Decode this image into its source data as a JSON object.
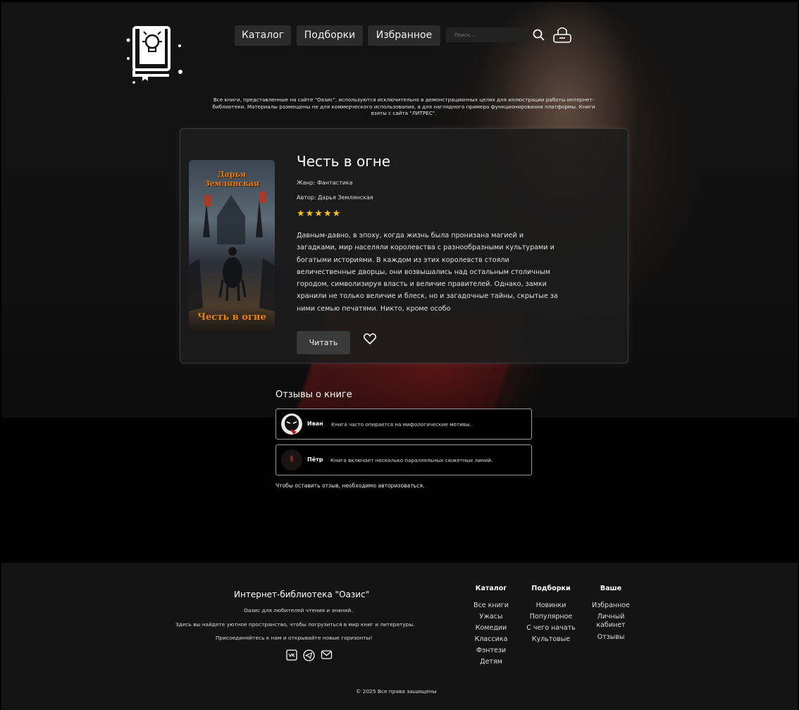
{
  "nav": {
    "catalog": "Каталог",
    "collections": "Подборки",
    "favorites": "Избранное",
    "search_placeholder": "Поиск..."
  },
  "disclaimer": "Все книги, представленные на сайте \"Оазис\", используются исключительно в демонстрационных целях для иллюстрации работы интернет-библиотеки. Материалы размещены не для коммерческого использования, а для наглядного примера функционирования платформы. Книги взяты с сайта \"ЛИТРЕС\".",
  "book": {
    "title": "Честь в огне",
    "genre": "Жанр: Фантастика",
    "author": "Автор: Дарья Землянская",
    "rating": 5,
    "stars": "★★★★★",
    "cover_author": "Дарья Землянская",
    "cover_title": "Честь в огне",
    "description": "Давным-давно, в эпоху, когда жизнь была пронизана магией и загадками, мир населяли королевства с разнообразными культурами и богатыми историями. В каждом из этих королевств стояли величественные дворцы, они возвышались над остальным столичным городом, символизируя власть и величие правителей. Однако, замки хранили не только величие и блеск, но и загадочные тайны, скрытые за ними семью печатями. Никто, кроме особо",
    "read_label": "Читать"
  },
  "reviews": {
    "title": "Отзывы о книге",
    "items": [
      {
        "name": "Иван",
        "text": "Книга часто опирается на мифологические мотивы."
      },
      {
        "name": "Пётр",
        "text": "Книга включает несколько параллельных сюжетных линий."
      }
    ],
    "auth_note": "Чтобы оставить отзыв, необходимо авторизоваться."
  },
  "footer": {
    "title": "Интернет-библиотека \"Оазис\"",
    "line1": "Оазис для любителей чтения и знаний.",
    "line2": "Здесь вы найдете уютное пространство, чтобы погрузиться в мир книг и литературы.",
    "line3": "Присоединяйтесь к нам и открывайте новые горизонты!",
    "columns": [
      {
        "head": "Каталог",
        "links": [
          "Все книги",
          "Ужасы",
          "Комедии",
          "Классика",
          "Фэнтези",
          "Детям"
        ]
      },
      {
        "head": "Подборки",
        "links": [
          "Новинки",
          "Популярное",
          "С чего начать",
          "Культовые"
        ]
      },
      {
        "head": "Ваше",
        "links": [
          "Избранное",
          "Личный кабинет",
          "Отзывы"
        ]
      }
    ],
    "copyright": "© 2025 Все права защищены"
  }
}
